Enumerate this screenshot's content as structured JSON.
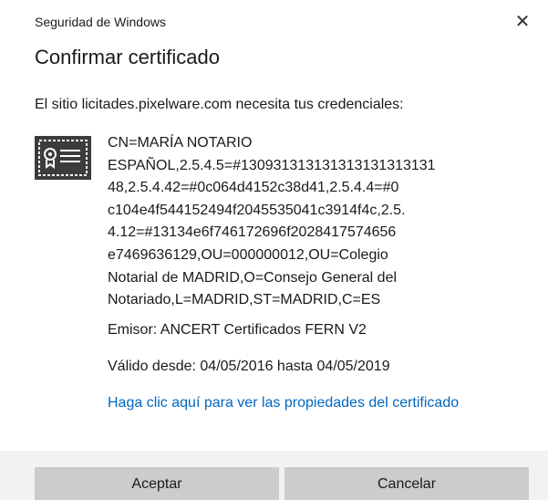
{
  "window": {
    "title": "Seguridad de Windows",
    "close_icon": "close-icon"
  },
  "dialog": {
    "heading": "Confirmar certificado",
    "subtitle": "El sitio licitades.pixelware.com necesita tus credenciales:"
  },
  "certificate": {
    "icon": "certificate-icon",
    "subject_lines": [
      "CN=MARÍA NOTARIO",
      "ESPAÑOL,2.5.4.5=#130931313131313131313131",
      "48,2.5.4.42=#0c064d4152c38d41,2.5.4.4=#0",
      "c104e4f544152494f2045535041c3914f4c,2.5.",
      "4.12=#13134e6f746172696f2028417574656",
      "e7469636129,OU=000000012,OU=Colegio",
      "Notarial de MADRID,O=Consejo General del",
      "Notariado,L=MADRID,ST=MADRID,C=ES"
    ],
    "issuer": "Emisor: ANCERT Certificados FERN V2",
    "validity": "Válido desde: 04/05/2016 hasta 04/05/2019",
    "properties_link": "Haga clic aquí para ver las propiedades del certificado"
  },
  "buttons": {
    "accept": "Aceptar",
    "cancel": "Cancelar"
  },
  "colors": {
    "link": "#0067c0",
    "button_bg": "#cccccc",
    "icon_bg": "#3c3c3c"
  }
}
